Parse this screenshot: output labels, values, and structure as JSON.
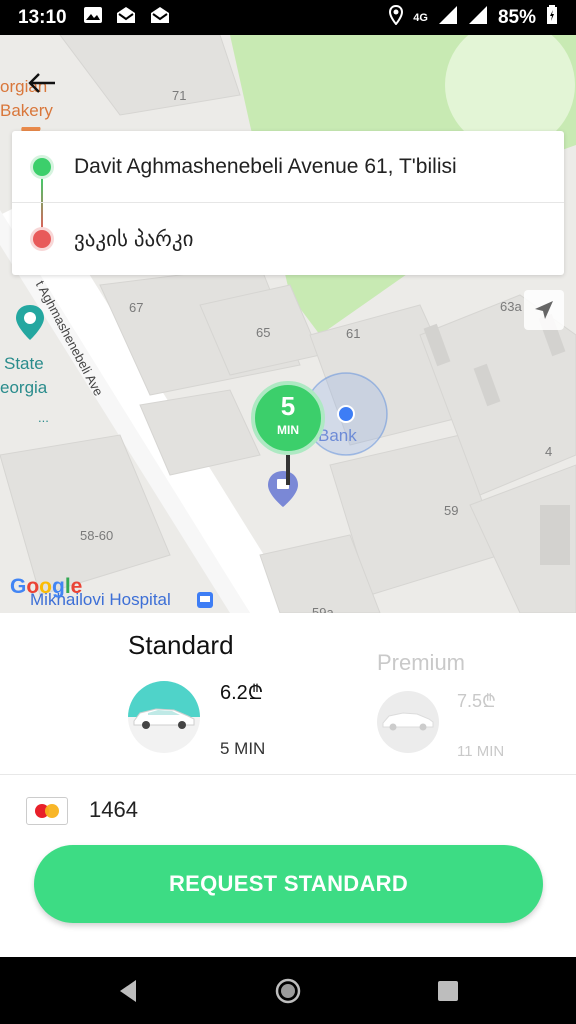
{
  "status_bar": {
    "time": "13:10",
    "network": "4G",
    "battery": "85%"
  },
  "map": {
    "labels": {
      "n71": "71",
      "n67": "67",
      "n65": "65",
      "n61": "61",
      "n63a": "63a",
      "n4": "4",
      "n59": "59",
      "n58_60": "58-60",
      "n59a": "59a"
    },
    "pois": {
      "bakery_1": "orgian",
      "bakery_2": "Bakery",
      "state_1": "State",
      "state_2": "eorgia",
      "state_3": "...",
      "bank": "Bank",
      "hospital": "Mikhailovi Hospital"
    },
    "street": "t Aghmashenebeli Ave",
    "google": [
      "G",
      "o",
      "o",
      "g",
      "l",
      "e"
    ]
  },
  "route": {
    "from": "Davit Aghmashenebeli Avenue 61, T'bilisi",
    "to": "ვაკის პარკი"
  },
  "eta_marker": {
    "value": "5",
    "unit": "MIN"
  },
  "options": {
    "standard": {
      "title": "Standard",
      "price": "6.2₾",
      "eta": "5 MIN"
    },
    "premium": {
      "title": "Premium",
      "price": "7.5₾",
      "eta": "11 MIN"
    }
  },
  "payment": {
    "card_number": "1464"
  },
  "request_button": "REQUEST STANDARD",
  "colors": {
    "accent": "#3ddc84",
    "origin": "#3ccf6b",
    "destination": "#e85a5a"
  }
}
